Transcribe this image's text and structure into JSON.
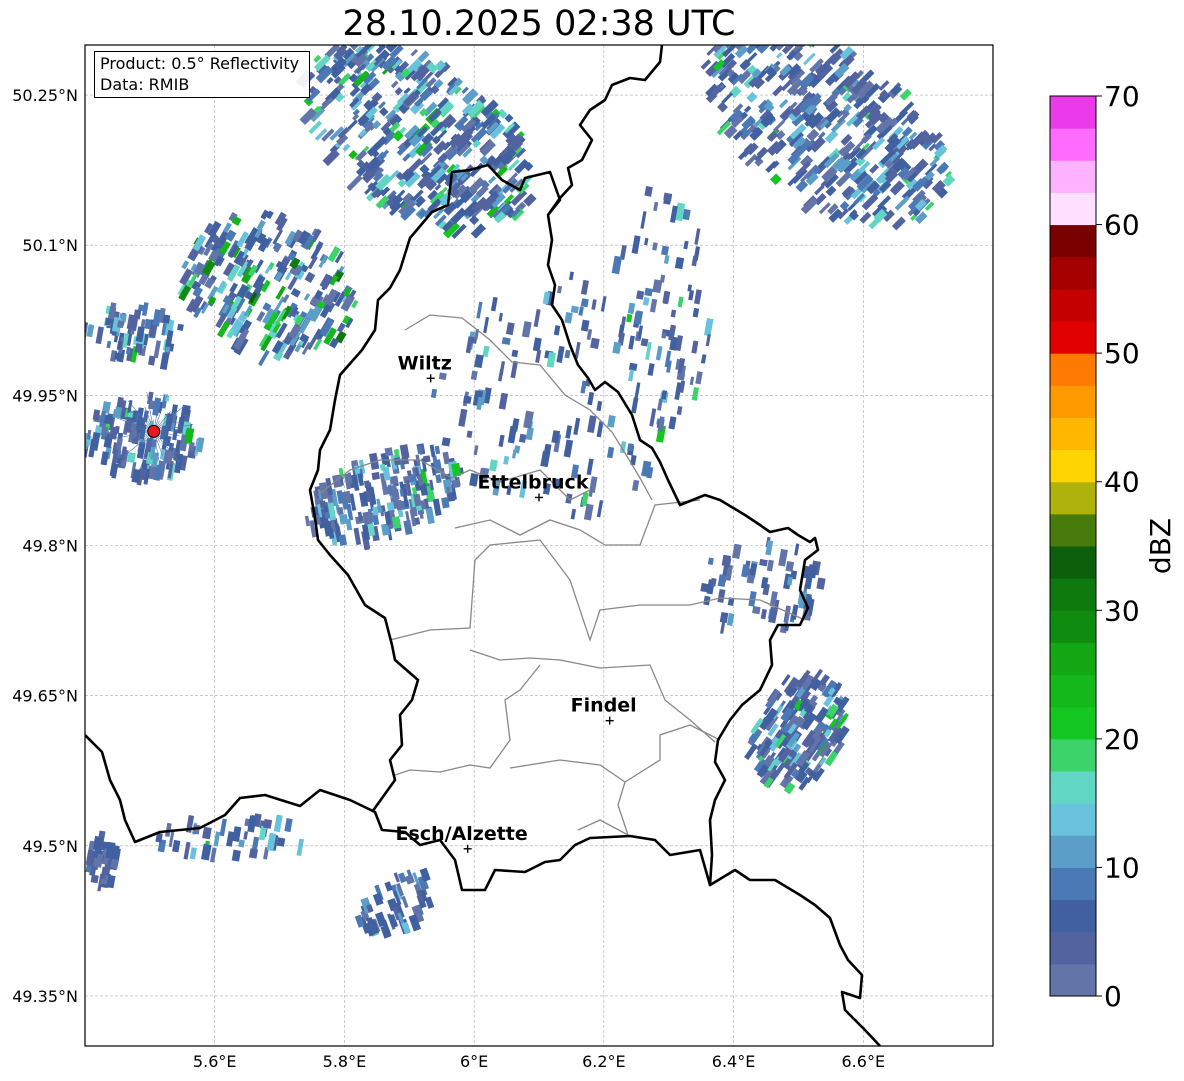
{
  "title": "28.10.2025 02:38 UTC",
  "info": {
    "product": "Product: 0.5° Reflectivity",
    "data": "Data: RMIB"
  },
  "map": {
    "lon_range": [
      5.4,
      6.8
    ],
    "lat_range": [
      49.3,
      50.3
    ],
    "x_ticks": [
      {
        "value": 5.6,
        "label": "5.6°E"
      },
      {
        "value": 5.8,
        "label": "5.8°E"
      },
      {
        "value": 6.0,
        "label": "6°E"
      },
      {
        "value": 6.2,
        "label": "6.2°E"
      },
      {
        "value": 6.4,
        "label": "6.4°E"
      },
      {
        "value": 6.6,
        "label": "6.6°E"
      }
    ],
    "y_ticks": [
      {
        "value": 50.25,
        "label": "50.25°N"
      },
      {
        "value": 50.1,
        "label": "50.1°N"
      },
      {
        "value": 49.95,
        "label": "49.95°N"
      },
      {
        "value": 49.8,
        "label": "49.8°N"
      },
      {
        "value": 49.65,
        "label": "49.65°N"
      },
      {
        "value": 49.5,
        "label": "49.5°N"
      },
      {
        "value": 49.35,
        "label": "49.35°N"
      }
    ],
    "gridlines": true,
    "cities": [
      {
        "name": "Wiltz",
        "lon": 5.933,
        "lat": 49.967
      },
      {
        "name": "Ettelbruck",
        "lon": 6.1,
        "lat": 49.848
      },
      {
        "name": "Findel",
        "lon": 6.209,
        "lat": 49.625
      },
      {
        "name": "Esch/Alzette",
        "lon": 5.99,
        "lat": 49.497
      }
    ],
    "radar_site": {
      "lon": 5.506,
      "lat": 49.914,
      "color": "#e41a1c"
    }
  },
  "colorbar": {
    "label": "dBZ",
    "min": 0,
    "max": 70,
    "ticks": [
      0,
      10,
      20,
      30,
      40,
      50,
      60,
      70
    ],
    "colors": [
      "#6374a8",
      "#52639f",
      "#4160a0",
      "#4a79b5",
      "#5b9fc8",
      "#68c2dc",
      "#62d6c4",
      "#3dd36b",
      "#13c620",
      "#14b81a",
      "#13a714",
      "#0f8c10",
      "#0e7a0e",
      "#0b5f0b",
      "#477b0c",
      "#aeb20a",
      "#ffd500",
      "#ffb700",
      "#ff9900",
      "#ff7a00",
      "#e00000",
      "#c40000",
      "#a50000",
      "#7a0000",
      "#ffe0ff",
      "#ffb3ff",
      "#ff6bff",
      "#ea3aea"
    ]
  }
}
